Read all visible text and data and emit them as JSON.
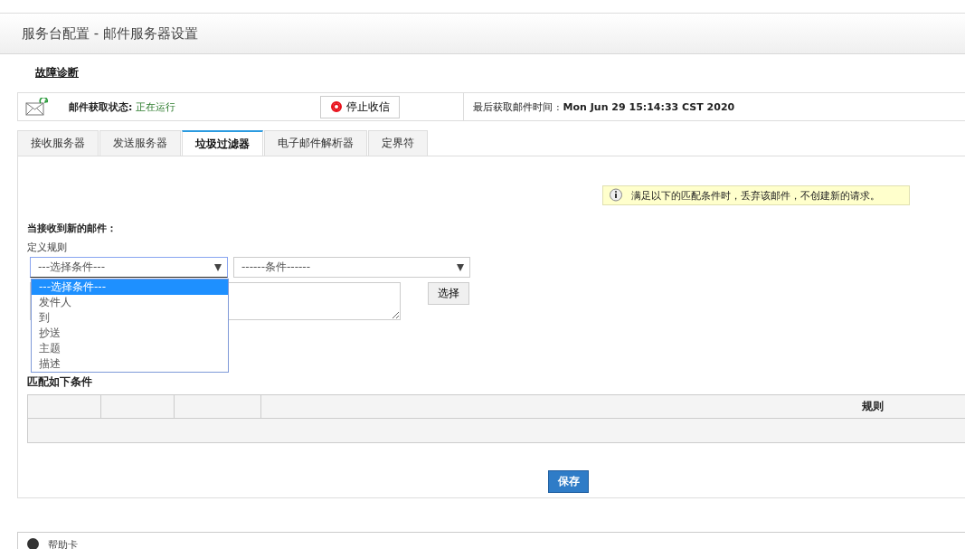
{
  "page_title": "服务台配置 - 邮件服务器设置",
  "troubleshoot_link": "故障诊断",
  "status_bar": {
    "label": "邮件获取状态:",
    "status": "正在运行",
    "stop_button": "停止收信",
    "last_fetch_label": "最后获取邮件时间 :",
    "last_fetch_time": "Mon Jun 29 15:14:33 CST 2020"
  },
  "tabs": [
    {
      "label": "接收服务器",
      "selected": false
    },
    {
      "label": "发送服务器",
      "selected": false
    },
    {
      "label": "垃圾过滤器",
      "selected": true
    },
    {
      "label": "电子邮件解析器",
      "selected": false
    },
    {
      "label": "定界符",
      "selected": false
    }
  ],
  "info_note": "满足以下的匹配条件时，丢弃该邮件，不创建新的请求。",
  "section_heading": "当接收到新的邮件：",
  "rule_label": "定义规则",
  "condition_select": {
    "value": "---选择条件---",
    "expanded": true,
    "options": [
      {
        "label": "---选择条件---",
        "selected": true
      },
      {
        "label": "发件人",
        "selected": false
      },
      {
        "label": "到",
        "selected": false
      },
      {
        "label": "抄送",
        "selected": false
      },
      {
        "label": "主题",
        "selected": false
      },
      {
        "label": "描述",
        "selected": false
      }
    ]
  },
  "operator_select": {
    "value": "------条件------"
  },
  "choose_button": "选择",
  "match_heading": "匹配如下条件",
  "table": {
    "columns": [
      "",
      "",
      "",
      "规则"
    ]
  },
  "save_button": "保存",
  "help_card": "帮助卡"
}
